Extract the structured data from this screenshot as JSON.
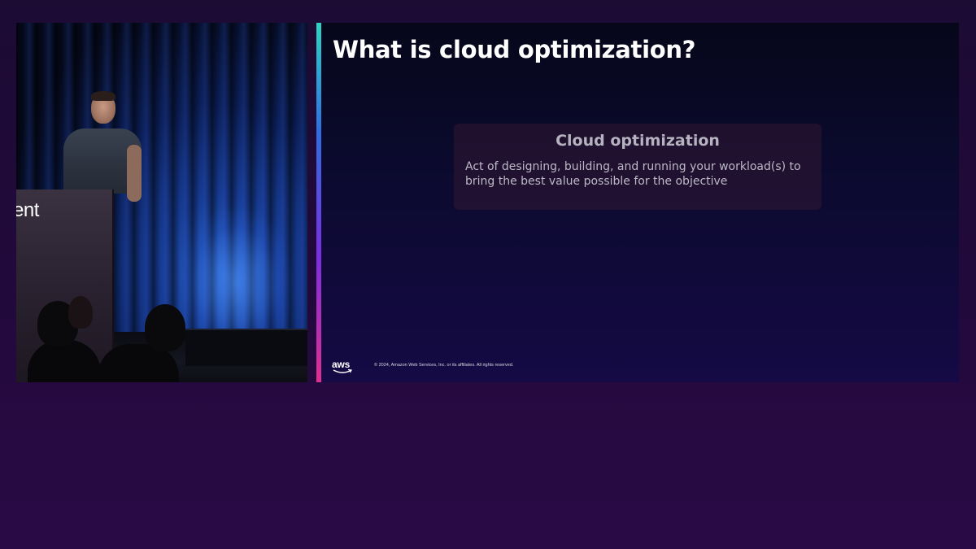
{
  "video": {
    "podium_text": "ent"
  },
  "slide": {
    "title": "What is cloud optimization?",
    "definition": {
      "heading": "Cloud optimization",
      "body": "Act of designing, building, and running your workload(s) to bring the best value possible for the objective"
    },
    "logo_text": "aws",
    "copyright": "© 2024, Amazon Web Services, Inc. or its affiliates. All rights reserved."
  },
  "colors": {
    "background": "#22093c",
    "slide_background": "#0b0a2e",
    "accent_top": "#2fd3c2",
    "accent_bottom": "#e02f8f",
    "title_text": "#ffffff"
  }
}
